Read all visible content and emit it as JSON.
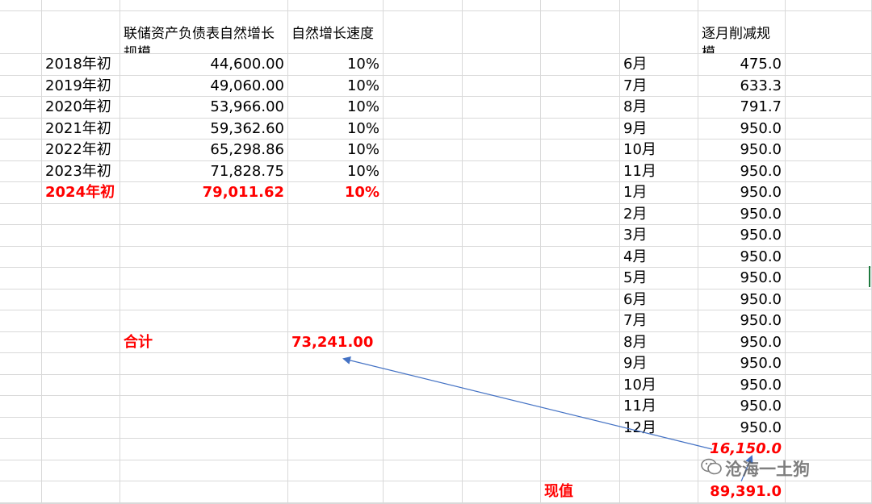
{
  "headers": {
    "col_b": "联储资产负债表自然增长规模",
    "col_c": "自然增长速度",
    "col_h": "逐月削减规模"
  },
  "left_rows": [
    {
      "label": "2018年初",
      "value": "44,600.00",
      "rate": "10%",
      "highlight": false
    },
    {
      "label": "2019年初",
      "value": "49,060.00",
      "rate": "10%",
      "highlight": false
    },
    {
      "label": "2020年初",
      "value": "53,966.00",
      "rate": "10%",
      "highlight": false
    },
    {
      "label": "2021年初",
      "value": "59,362.60",
      "rate": "10%",
      "highlight": false
    },
    {
      "label": "2022年初",
      "value": "65,298.86",
      "rate": "10%",
      "highlight": false
    },
    {
      "label": "2023年初",
      "value": "71,828.75",
      "rate": "10%",
      "highlight": false
    },
    {
      "label": "2024年初",
      "value": "79,011.62",
      "rate": "10%",
      "highlight": true
    }
  ],
  "sum": {
    "label": "合计",
    "value": "73,241.00"
  },
  "right_rows": [
    {
      "month": "6月",
      "value": "475.0"
    },
    {
      "month": "7月",
      "value": "633.3"
    },
    {
      "month": "8月",
      "value": "791.7"
    },
    {
      "month": "9月",
      "value": "950.0"
    },
    {
      "month": "10月",
      "value": "950.0"
    },
    {
      "month": "11月",
      "value": "950.0"
    },
    {
      "month": "1月",
      "value": "950.0"
    },
    {
      "month": "2月",
      "value": "950.0"
    },
    {
      "month": "3月",
      "value": "950.0"
    },
    {
      "month": "4月",
      "value": "950.0"
    },
    {
      "month": "5月",
      "value": "950.0"
    },
    {
      "month": "6月",
      "value": "950.0"
    },
    {
      "month": "7月",
      "value": "950.0"
    },
    {
      "month": "8月",
      "value": "950.0"
    },
    {
      "month": "9月",
      "value": "950.0"
    },
    {
      "month": "10月",
      "value": "950.0"
    },
    {
      "month": "11月",
      "value": "950.0"
    },
    {
      "month": "12月",
      "value": "950.0"
    }
  ],
  "total_reduction": "16,150.0",
  "present_value": {
    "label": "现值",
    "value": "89,391.0"
  },
  "watermark": "沧海一土狗",
  "colors": {
    "gridline": "#d9d9d9",
    "highlight": "#ff0000",
    "arrow": "#4472c4"
  }
}
